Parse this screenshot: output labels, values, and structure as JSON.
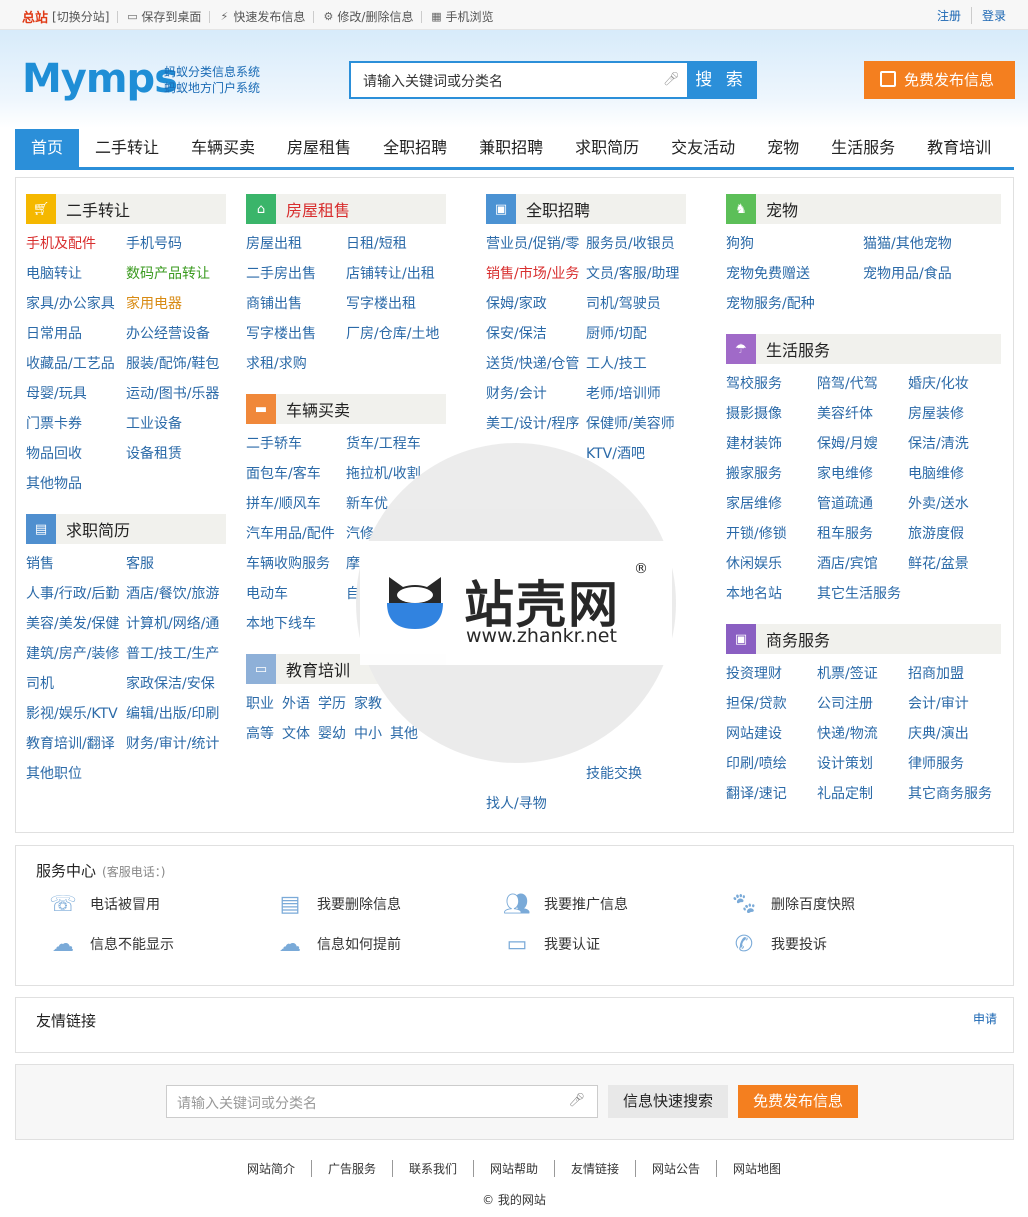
{
  "topbar": {
    "site": "总站",
    "switch": "[切换分站]",
    "items": [
      {
        "icon": "desktop-icon",
        "label": "保存到桌面"
      },
      {
        "icon": "lightning-icon",
        "label": "快速发布信息"
      },
      {
        "icon": "gear-icon",
        "label": "修改/删除信息"
      },
      {
        "icon": "qrcode-icon",
        "label": "手机浏览"
      }
    ],
    "register": "注册",
    "login": "登录"
  },
  "header": {
    "logo": "Mymps",
    "slogan1": "蚂蚁分类信息系统",
    "slogan2": "蚂蚁地方门户系统",
    "search_placeholder": "请输入关键词或分类名",
    "search_button": "搜 索",
    "publish_button": "免费发布信息"
  },
  "nav": [
    "首页",
    "二手转让",
    "车辆买卖",
    "房屋租售",
    "全职招聘",
    "兼职招聘",
    "求职简历",
    "交友活动",
    "宠物",
    "生活服务",
    "教育培训"
  ],
  "categories": {
    "secondhand": {
      "title": "二手转让",
      "items": [
        "手机及配件",
        "手机号码",
        "电脑转让",
        "数码产品转让",
        "家具/办公家具",
        "家用电器",
        "日常用品",
        "办公经营设备",
        "收藏品/工艺品",
        "服装/配饰/鞋包",
        "母婴/玩具",
        "运动/图书/乐器",
        "门票卡券",
        "工业设备",
        "物品回收",
        "设备租赁",
        "其他物品"
      ]
    },
    "resume": {
      "title": "求职简历",
      "items": [
        "销售",
        "客服",
        "人事/行政/后勤",
        "酒店/餐饮/旅游",
        "美容/美发/保健",
        "计算机/网络/通",
        "建筑/房产/装修",
        "普工/技工/生产",
        "司机",
        "家政保洁/安保",
        "影视/娱乐/KTV",
        "编辑/出版/印刷",
        "教育培训/翻译",
        "财务/审计/统计",
        "其他职位"
      ]
    },
    "house": {
      "title": "房屋租售",
      "items": [
        "房屋出租",
        "日租/短租",
        "二手房出售",
        "店铺转让/出租",
        "商铺出售",
        "写字楼出租",
        "写字楼出售",
        "厂房/仓库/土地",
        "求租/求购"
      ]
    },
    "car": {
      "title": "车辆买卖",
      "items": [
        "二手轿车",
        "货车/工程车",
        "面包车/客车",
        "拖拉机/收割",
        "拼车/顺风车",
        "新车优",
        "汽车用品/配件",
        "汽修",
        "车辆收购服务",
        "摩",
        "电动车",
        "自",
        "本地下线车"
      ]
    },
    "edu": {
      "title": "教育培训",
      "items": [
        "职业",
        "外语",
        "学历",
        "家教",
        "高等",
        "文体",
        "婴幼",
        "中小",
        "其他"
      ]
    },
    "job": {
      "title": "全职招聘",
      "items": [
        "营业员/促销/零",
        "服务员/收银员",
        "销售/市场/业务",
        "文员/客服/助理",
        "保姆/家政",
        "司机/驾驶员",
        "保安/保洁",
        "厨师/切配",
        "送货/快递/仓管",
        "工人/技工",
        "财务/会计",
        "老师/培训师",
        "美工/设计/程序",
        "保健师/美容师",
        "KTV/酒吧",
        "技能交换",
        "找人/寻物"
      ]
    },
    "pet": {
      "title": "宠物",
      "items": [
        "狗狗",
        "猫猫/其他宠物",
        "宠物免费赠送",
        "宠物用品/食品",
        "宠物服务/配种"
      ]
    },
    "life": {
      "title": "生活服务",
      "items": [
        "驾校服务",
        "陪驾/代驾",
        "婚庆/化妆",
        "摄影摄像",
        "美容纤体",
        "房屋装修",
        "建材装饰",
        "保姆/月嫂",
        "保洁/清洗",
        "搬家服务",
        "家电维修",
        "电脑维修",
        "家居维修",
        "管道疏通",
        "外卖/送水",
        "开锁/修锁",
        "租车服务",
        "旅游度假",
        "休闲娱乐",
        "酒店/宾馆",
        "鲜花/盆景",
        "本地名站",
        "其它生活服务"
      ]
    },
    "biz": {
      "title": "商务服务",
      "items": [
        "投资理财",
        "机票/签证",
        "招商加盟",
        "担保/贷款",
        "公司注册",
        "会计/审计",
        "网站建设",
        "快递/物流",
        "庆典/演出",
        "印刷/喷绘",
        "设计策划",
        "律师服务",
        "翻译/速记",
        "礼品定制",
        "其它商务服务"
      ]
    }
  },
  "service": {
    "title": "服务中心",
    "phone_label": "(客服电话：)",
    "items": [
      "电话被冒用",
      "我要删除信息",
      "我要推广信息",
      "删除百度快照",
      "信息不能显示",
      "信息如何提前",
      "我要认证",
      "我要投诉"
    ]
  },
  "links": {
    "title": "友情链接",
    "apply": "申请"
  },
  "bottom_search": {
    "placeholder": "请输入关键词或分类名",
    "quick_button": "信息快速搜索",
    "publish_button": "免费发布信息"
  },
  "footer": {
    "links": [
      "网站简介",
      "广告服务",
      "联系我们",
      "网站帮助",
      "友情链接",
      "网站公告",
      "网站地图"
    ],
    "copyright": "© 我的网站"
  },
  "watermark": {
    "name": "站壳网",
    "url": "www.zhankr.net",
    "mark": "®"
  },
  "colors": {
    "brand_blue": "#2b8fd9",
    "orange": "#f47f1f",
    "link_blue": "#2b6aa8",
    "red": "#d82f2f"
  }
}
